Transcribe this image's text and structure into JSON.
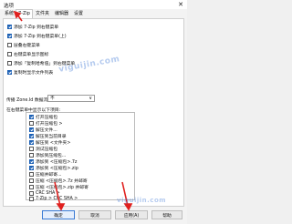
{
  "window": {
    "title": "选项",
    "close_glyph": "✕"
  },
  "tabs": [
    "系统",
    "7-Zip",
    "文件夹",
    "编辑器",
    "设置"
  ],
  "options": [
    {
      "label": "添加 7-Zip 到右键菜单",
      "checked": true
    },
    {
      "label": "添加 7-Zip 到右键菜单(上)",
      "checked": true
    },
    {
      "label": "层叠右键菜单",
      "checked": false
    },
    {
      "label": "右键菜单显示图标",
      "checked": false
    },
    {
      "label": "添加「复制哈希值」到右键菜单",
      "checked": false
    },
    {
      "label": "复制时显示文件列表",
      "checked": true
    }
  ],
  "zone": {
    "label": "传播 Zone.Id 数据流:",
    "value": "不",
    "chevron": "∨"
  },
  "section_label": "在右键菜单中显示以下项目:",
  "menu_items": [
    {
      "label": "打开压缩包",
      "checked": true
    },
    {
      "label": "打开压缩包 >",
      "checked": false
    },
    {
      "label": "解压文件...",
      "checked": true
    },
    {
      "label": "解压到当前目录",
      "checked": true
    },
    {
      "label": "解压到 <文件夹>",
      "checked": true
    },
    {
      "label": "测试压缩包",
      "checked": false
    },
    {
      "label": "添加到压缩包...",
      "checked": false
    },
    {
      "label": "添加到 <压缩包>.7z",
      "checked": true
    },
    {
      "label": "添加到 <压缩包>.zip",
      "checked": true
    },
    {
      "label": "压缩并邮寄...",
      "checked": false
    },
    {
      "label": "压缩 <压缩包>.7z 并邮寄",
      "checked": false
    },
    {
      "label": "压缩 <压缩包>.zip 并邮寄",
      "checked": false
    },
    {
      "label": "CRC SHA >",
      "checked": false
    },
    {
      "label": "7-Zip > CRC SHA >",
      "checked": false
    }
  ],
  "buttons": {
    "ok": "确定",
    "cancel": "取消",
    "apply": "应用(A)",
    "help": "帮助"
  },
  "watermark": "viguijin.com",
  "colors": {
    "accent": "#1a5fb4",
    "arrow": "#e0201e"
  }
}
